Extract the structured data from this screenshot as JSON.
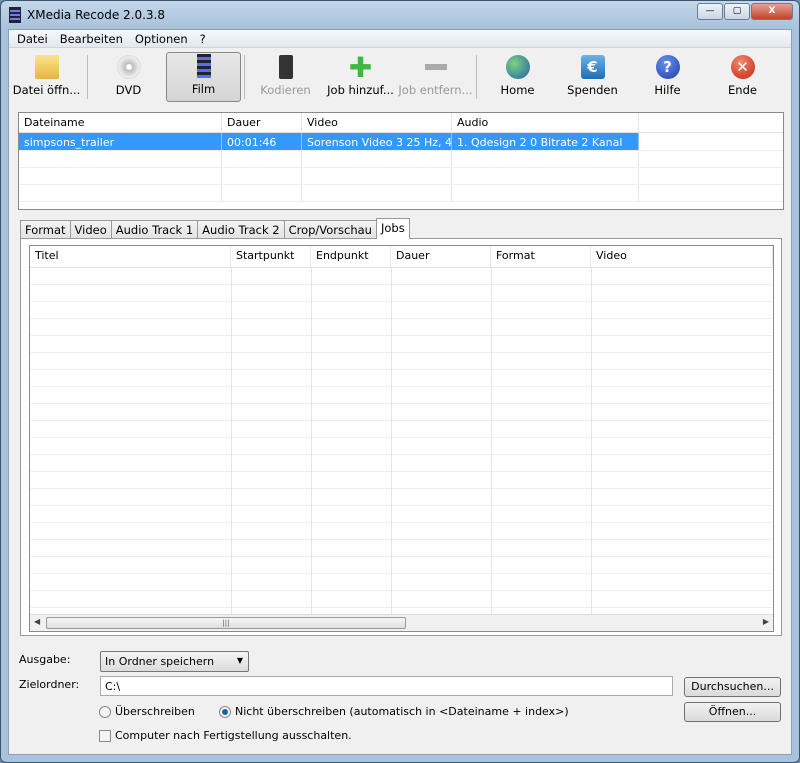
{
  "window": {
    "title": "XMedia Recode 2.0.3.8"
  },
  "menu": [
    "Datei",
    "Bearbeiten",
    "Optionen",
    "?"
  ],
  "toolbar": [
    {
      "label": "Datei öffn...",
      "icon": "folder-open-icon",
      "state": "normal"
    },
    {
      "label": "DVD",
      "icon": "dvd-icon",
      "state": "normal"
    },
    {
      "label": "Film",
      "icon": "film-icon",
      "state": "active"
    },
    {
      "label": "Kodieren",
      "icon": "encode-icon",
      "state": "disabled"
    },
    {
      "label": "Job hinzuf...",
      "icon": "plus-icon",
      "state": "normal"
    },
    {
      "label": "Job entfern...",
      "icon": "minus-icon",
      "state": "disabled"
    },
    {
      "label": "Home",
      "icon": "globe-icon",
      "state": "normal"
    },
    {
      "label": "Spenden",
      "icon": "euro-icon",
      "state": "normal"
    },
    {
      "label": "Hilfe",
      "icon": "help-icon",
      "state": "normal"
    },
    {
      "label": "Ende",
      "icon": "exit-icon",
      "state": "normal"
    }
  ],
  "files": {
    "columns": [
      "Dateiname",
      "Dauer",
      "Video",
      "Audio",
      ""
    ],
    "rows": [
      [
        "simpsons_trailer",
        "00:01:46",
        "Sorenson Video 3 25 Hz, 4...",
        "1. Qdesign 2 0 Bitrate 2 Kanal",
        ""
      ]
    ]
  },
  "tabs": [
    "Format",
    "Video",
    "Audio Track 1",
    "Audio Track 2",
    "Crop/Vorschau",
    "Jobs"
  ],
  "active_tab": "Jobs",
  "jobs": {
    "columns": [
      "Titel",
      "Startpunkt",
      "Endpunkt",
      "Dauer",
      "Format",
      "Video"
    ],
    "rows": []
  },
  "output": {
    "ausgabe_label": "Ausgabe:",
    "ausgabe_value": "In Ordner speichern",
    "ziel_label": "Zielordner:",
    "ziel_value": "C:\\",
    "browse": "Durchsuchen...",
    "open": "Öffnen...",
    "radio_overwrite": "Überschreiben",
    "radio_no_overwrite": "Nicht überschreiben (automatisch in <Dateiname + index>)",
    "selected_radio": "no_overwrite",
    "shutdown": "Computer nach Fertigstellung ausschalten.",
    "shutdown_checked": false
  }
}
